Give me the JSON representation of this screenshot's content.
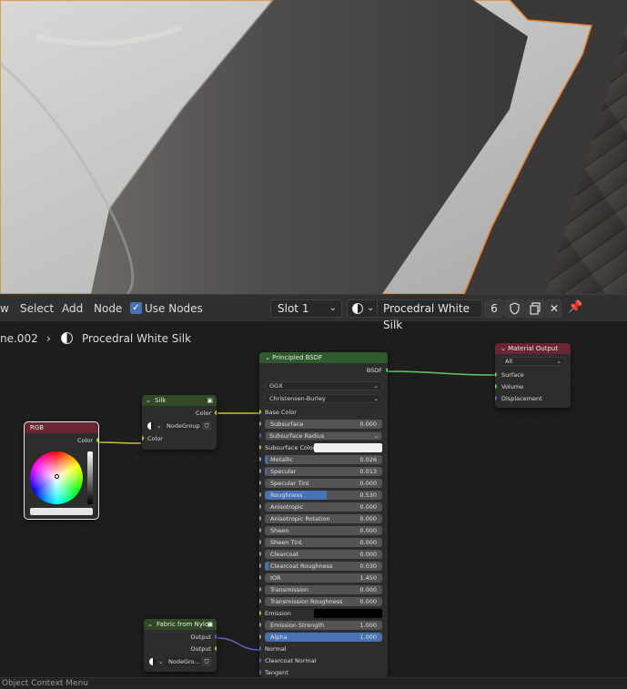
{
  "header": {
    "menu": [
      "w",
      "Select",
      "Add",
      "Node"
    ],
    "use_nodes_label": "Use Nodes",
    "slot_label": "Slot 1",
    "material_name": "Procedral White Silk",
    "user_count": "6"
  },
  "breadcrumb": {
    "object": "ne.002",
    "material": "Procedral White Silk"
  },
  "nodes": {
    "rgb": {
      "title": "RGB",
      "color_label": "Color"
    },
    "silk": {
      "title": "Silk",
      "output": "Color",
      "group_label": "NodeGroup",
      "input": "Color"
    },
    "fabric": {
      "title": "Fabric from Nylon",
      "out1": "Output",
      "out2": "Output",
      "group_label": "NodeGro..."
    },
    "material_output": {
      "title": "Material Output",
      "target": "All",
      "inputs": [
        "Surface",
        "Volume",
        "Displacement"
      ]
    },
    "principled": {
      "title": "Principled BSDF",
      "output": "BSDF",
      "distribution": "GGX",
      "subsurface_method": "Christensen-Burley",
      "base_color_label": "Base Color",
      "subsurface_radius_label": "Subsurface Radius",
      "subsurface_color_label": "Subsurface Color",
      "emission_label": "Emission",
      "sliders": [
        {
          "label": "Subsurface",
          "value": "0.000",
          "fraction": 0
        },
        {
          "label": "Metallic",
          "value": "0.026",
          "fraction": 0.026
        },
        {
          "label": "Specular",
          "value": "0.013",
          "fraction": 0.013
        },
        {
          "label": "Specular Tint",
          "value": "0.000",
          "fraction": 0
        },
        {
          "label": "Roughness",
          "value": "0.530",
          "fraction": 0.53
        },
        {
          "label": "Anisotropic",
          "value": "0.000",
          "fraction": 0
        },
        {
          "label": "Anisotropic Rotation",
          "value": "0.000",
          "fraction": 0
        },
        {
          "label": "Sheen",
          "value": "0.000",
          "fraction": 0
        },
        {
          "label": "Sheen Tint",
          "value": "0.000",
          "fraction": 0
        },
        {
          "label": "Clearcoat",
          "value": "0.000",
          "fraction": 0
        },
        {
          "label": "Clearcoat Roughness",
          "value": "0.030",
          "fraction": 0.03
        },
        {
          "label": "IOR",
          "value": "1.450",
          "fraction": 0
        },
        {
          "label": "Transmission",
          "value": "0.000",
          "fraction": 0
        },
        {
          "label": "Transmission Roughness",
          "value": "0.000",
          "fraction": 0
        },
        {
          "label": "Emission Strength",
          "value": "1.000",
          "fraction": 0
        },
        {
          "label": "Alpha",
          "value": "1.000",
          "fraction": 1
        }
      ],
      "vector_inputs": [
        "Normal",
        "Clearcoat Normal",
        "Tangent"
      ]
    }
  },
  "status_bar": {
    "text": "Object Context Menu"
  },
  "colors": {
    "accent": "#4772b3",
    "selection_outline": "#e8832b",
    "shader_header": "#2e5a2e",
    "output_header": "#6a2733",
    "group_header": "#2f4a24",
    "color_socket": "#c7c729",
    "shader_socket": "#63c763",
    "vector_socket": "#6363c7",
    "float_socket": "#a1a1a1"
  }
}
